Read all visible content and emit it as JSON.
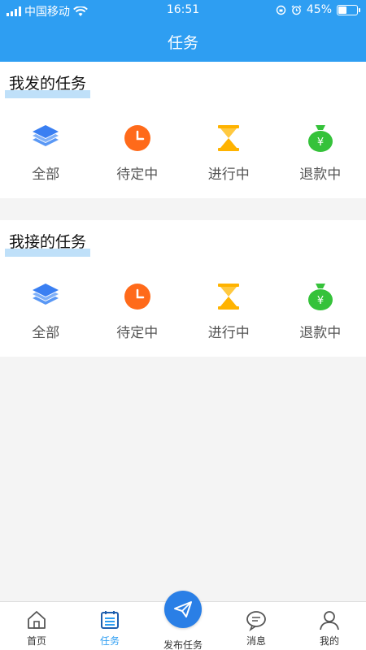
{
  "status_bar": {
    "carrier": "中国移动",
    "time": "16:51",
    "battery": "45%",
    "battery_level": 0.45
  },
  "header": {
    "title": "任务"
  },
  "sections": [
    {
      "title": "我发的任务",
      "items": [
        {
          "label": "全部",
          "icon": "layers-icon"
        },
        {
          "label": "待定中",
          "icon": "clock-icon"
        },
        {
          "label": "进行中",
          "icon": "hourglass-icon"
        },
        {
          "label": "退款中",
          "icon": "money-bag-icon"
        }
      ]
    },
    {
      "title": "我接的任务",
      "items": [
        {
          "label": "全部",
          "icon": "layers-icon"
        },
        {
          "label": "待定中",
          "icon": "clock-icon"
        },
        {
          "label": "进行中",
          "icon": "hourglass-icon"
        },
        {
          "label": "退款中",
          "icon": "money-bag-icon"
        }
      ]
    }
  ],
  "tab_bar": {
    "items": [
      {
        "label": "首页",
        "icon": "home-icon"
      },
      {
        "label": "任务",
        "icon": "task-list-icon",
        "active": true
      },
      {
        "label": "发布任务",
        "icon": "paper-plane-icon"
      },
      {
        "label": "消息",
        "icon": "chat-bubble-icon"
      },
      {
        "label": "我的",
        "icon": "profile-icon"
      }
    ]
  },
  "colors": {
    "primary": "#2e9ef2",
    "highlight": "#bfe0f9",
    "fab": "#2a7fe6",
    "clock": "#ff6a1a",
    "hourglass": "#ffb300",
    "money": "#35c23a",
    "layers": "#3a7ff2"
  }
}
